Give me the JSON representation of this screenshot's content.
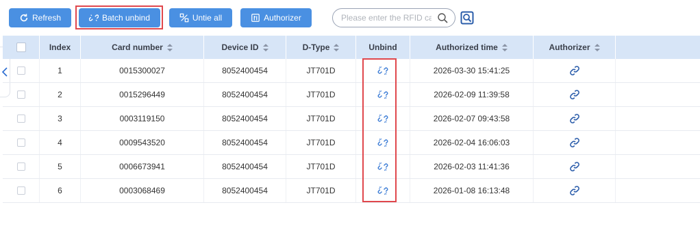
{
  "toolbar": {
    "refresh_label": "Refresh",
    "batch_unbind_label": "Batch unbind",
    "untie_all_label": "Untie all",
    "authorizer_label": "Authorizer",
    "search_placeholder": "Please enter the RFID card number",
    "accent_color": "#4a90e2"
  },
  "table": {
    "columns": [
      "Index",
      "Card number",
      "Device ID",
      "D-Type",
      "Unbind",
      "Authorized time",
      "Authorizer"
    ],
    "rows": [
      {
        "index": "1",
        "card": "0015300027",
        "device": "8052400454",
        "dtype": "JT701D",
        "time": "2026-03-30 15:41:25"
      },
      {
        "index": "2",
        "card": "0015296449",
        "device": "8052400454",
        "dtype": "JT701D",
        "time": "2026-02-09 11:39:58"
      },
      {
        "index": "3",
        "card": "0003119150",
        "device": "8052400454",
        "dtype": "JT701D",
        "time": "2026-02-07 09:43:58"
      },
      {
        "index": "4",
        "card": "0009543520",
        "device": "8052400454",
        "dtype": "JT701D",
        "time": "2026-02-04 16:06:03"
      },
      {
        "index": "5",
        "card": "0006673941",
        "device": "8052400454",
        "dtype": "JT701D",
        "time": "2026-02-03 11:41:36"
      },
      {
        "index": "6",
        "card": "0003068469",
        "device": "8052400454",
        "dtype": "JT701D",
        "time": "2026-01-08 16:13:48"
      }
    ]
  },
  "icons": {
    "unbind": "unlink-icon",
    "authorizer": "link-icon",
    "highlight_color": "#e0474c"
  }
}
